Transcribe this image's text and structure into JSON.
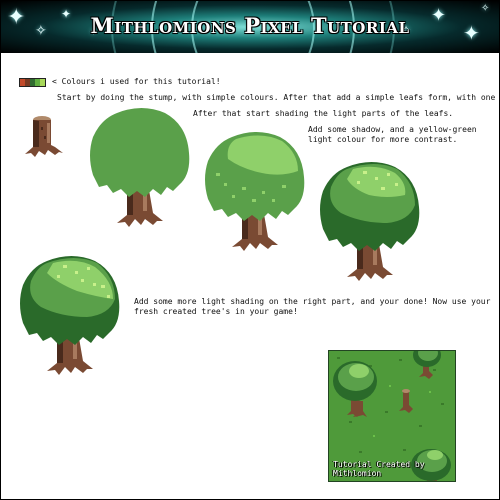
{
  "header": {
    "title": "Mithlomions Pixel Tutorial"
  },
  "palette": {
    "label": "< Colours i used for this tutorial!",
    "colors": [
      "#c24a2a",
      "#7a3a22",
      "#2f6b2f",
      "#5fae3f",
      "#a8d85a"
    ]
  },
  "steps": [
    "Start by doing the stump, with simple colours. After that add a simple leafs form, with one colour.",
    "After that start shading the light parts of the leafs.",
    "Add some shadow, and a yellow-green",
    "light colour for more contrast.",
    "Add some more light shading on the right part, and your done! Now use your",
    "fresh created tree's in your game!"
  ],
  "screenshot": {
    "caption_line1": "Tutorial Created by",
    "caption_line2": "Mithlomion"
  },
  "colors": {
    "bark_dark": "#4a2a1c",
    "bark": "#7a4a33",
    "bark_light": "#a87a5e",
    "leaf_dark": "#2a6a2a",
    "leaf": "#5aa04a",
    "leaf_light": "#8fd06a",
    "leaf_highlight": "#c8f08a",
    "grass": "#4f9a3a",
    "grass_dark": "#3a7a2a"
  }
}
